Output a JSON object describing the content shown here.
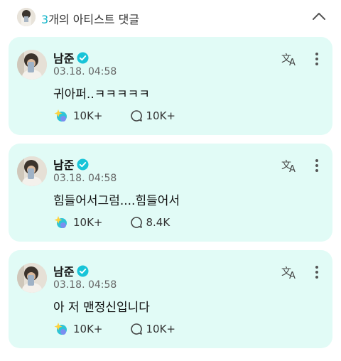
{
  "header": {
    "count": "3",
    "title_suffix": "개의 아티스트 댓글"
  },
  "comments": [
    {
      "author": "남준",
      "date": "03.18. 04:58",
      "text": "귀아퍼..ㅋㅋㅋㅋㅋ",
      "likes": "10K+",
      "replies": "10K+"
    },
    {
      "author": "남준",
      "date": "03.18. 04:58",
      "text": "힘들어서그럼....힘들어서",
      "likes": "10K+",
      "replies": "8.4K"
    },
    {
      "author": "남준",
      "date": "03.18. 04:58",
      "text": "아 저 맨정신입니다",
      "likes": "10K+",
      "replies": "10K+"
    }
  ],
  "icons": {
    "verified": "verified-badge-icon",
    "translate": "translate-icon",
    "more": "more-vertical-icon",
    "like": "sparkle-like-icon",
    "reply": "speech-bubble-icon",
    "collapse": "chevron-up-icon"
  },
  "colors": {
    "accent": "#12b5c9",
    "card_background": "#e1fbf6",
    "verified": "#18c4d8"
  }
}
